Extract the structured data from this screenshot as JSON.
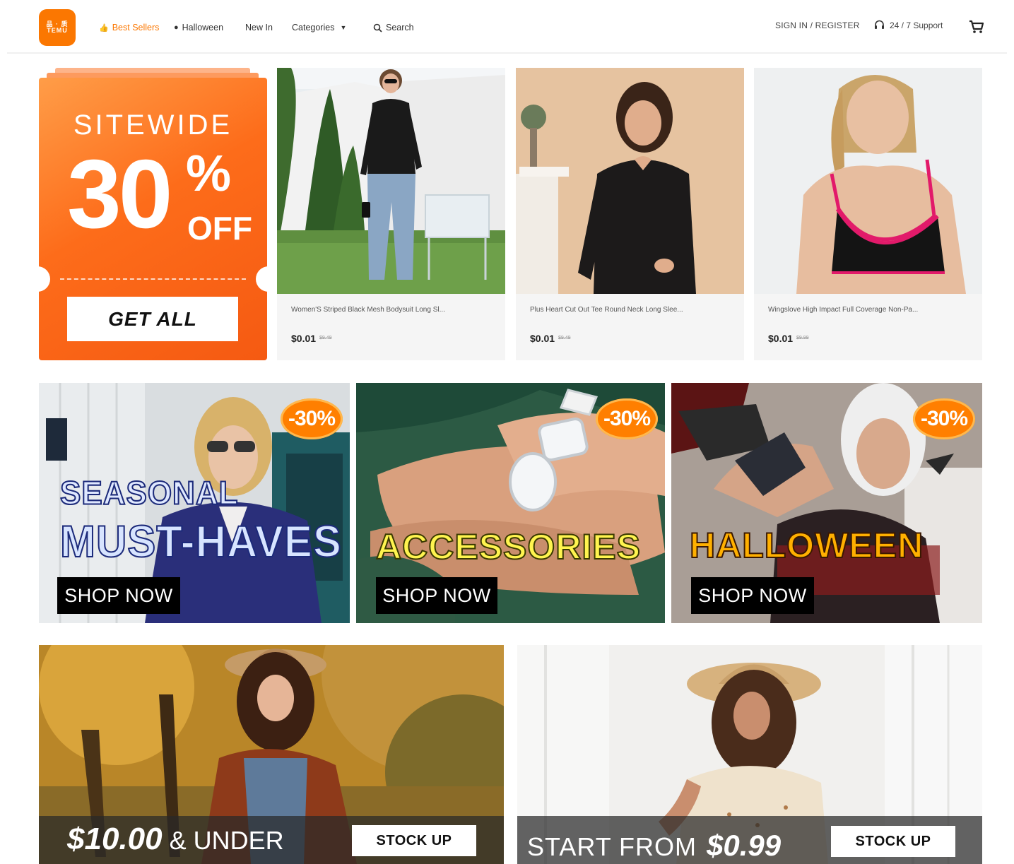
{
  "header": {
    "logo": {
      "line1": "品 · 质",
      "line2": "TEMU"
    },
    "nav": {
      "best_sellers": "Best Sellers",
      "halloween": "Halloween",
      "new_in": "New In",
      "categories": "Categories",
      "search": "Search"
    },
    "sign_in": "SIGN IN / REGISTER",
    "support": "24 / 7 Support"
  },
  "coupon": {
    "headline": "SITEWIDE",
    "amount": "30",
    "percent": "%",
    "off": "OFF",
    "button": "GET ALL"
  },
  "products": [
    {
      "title": "Women'S Striped Black Mesh Bodysuit Long Sl...",
      "price": "$0.01",
      "original_price": "$9.49"
    },
    {
      "title": "Plus Heart Cut Out Tee Round Neck Long Slee...",
      "price": "$0.01",
      "original_price": "$9.49"
    },
    {
      "title": "Wingslove High Impact Full Coverage Non-Pa...",
      "price": "$0.01",
      "original_price": "$9.99"
    }
  ],
  "category_banners": [
    {
      "line1": "SEASONAL",
      "line2": "MUST-HAVES",
      "badge": "-30%",
      "button": "SHOP NOW"
    },
    {
      "line1": "ACCESSORIES",
      "badge": "-30%",
      "button": "SHOP NOW"
    },
    {
      "line1": "HALLOWEEN",
      "badge": "-30%",
      "button": "SHOP NOW"
    }
  ],
  "promos": [
    {
      "amount": "$10.00",
      "suffix": "& UNDER",
      "button": "STOCK UP"
    },
    {
      "prefix": "START FROM",
      "amount": "$0.99",
      "button": "STOCK UP"
    }
  ],
  "colors": {
    "brand_orange": "#fb7701",
    "badge_orange": "#ff7f00"
  }
}
